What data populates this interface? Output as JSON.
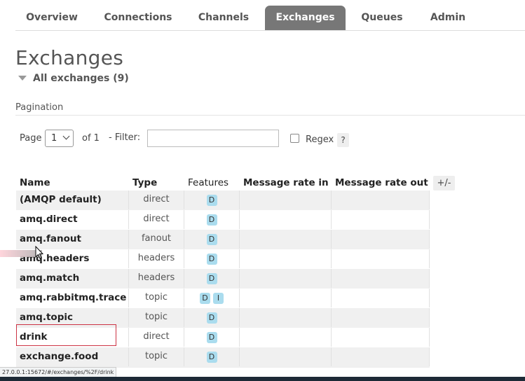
{
  "nav": {
    "tabs": [
      {
        "label": "Overview"
      },
      {
        "label": "Connections"
      },
      {
        "label": "Channels"
      },
      {
        "label": "Exchanges",
        "active": true
      },
      {
        "label": "Queues"
      },
      {
        "label": "Admin"
      }
    ]
  },
  "page": {
    "title": "Exchanges",
    "section_label": "All exchanges (9)"
  },
  "pagination": {
    "heading": "Pagination",
    "page_label": "Page",
    "page_value": "1",
    "of_label": "of 1",
    "filter_label": "- Filter:",
    "filter_value": "",
    "regex_label": "Regex",
    "help_label": "?"
  },
  "table": {
    "headers": {
      "name": "Name",
      "type": "Type",
      "features": "Features",
      "rate_in": "Message rate in",
      "rate_out": "Message rate out"
    },
    "columns_toggle": "+/-",
    "rows": [
      {
        "name": "(AMQP default)",
        "type": "direct",
        "features": [
          "D"
        ]
      },
      {
        "name": "amq.direct",
        "type": "direct",
        "features": [
          "D"
        ]
      },
      {
        "name": "amq.fanout",
        "type": "fanout",
        "features": [
          "D"
        ]
      },
      {
        "name": "amq.headers",
        "type": "headers",
        "features": [
          "D"
        ]
      },
      {
        "name": "amq.match",
        "type": "headers",
        "features": [
          "D"
        ]
      },
      {
        "name": "amq.rabbitmq.trace",
        "type": "topic",
        "features": [
          "D",
          "I"
        ]
      },
      {
        "name": "amq.topic",
        "type": "topic",
        "features": [
          "D"
        ]
      },
      {
        "name": "drink",
        "type": "direct",
        "features": [
          "D"
        ],
        "highlighted": true
      },
      {
        "name": "exchange.food",
        "type": "topic",
        "features": [
          "D"
        ]
      }
    ]
  },
  "status_bar": {
    "url": "27.0.0.1:15672/#/exchanges/%2F/drink"
  },
  "colors": {
    "active_tab": "#777777",
    "badge": "#aadcee",
    "highlight_border": "#cc3344"
  }
}
